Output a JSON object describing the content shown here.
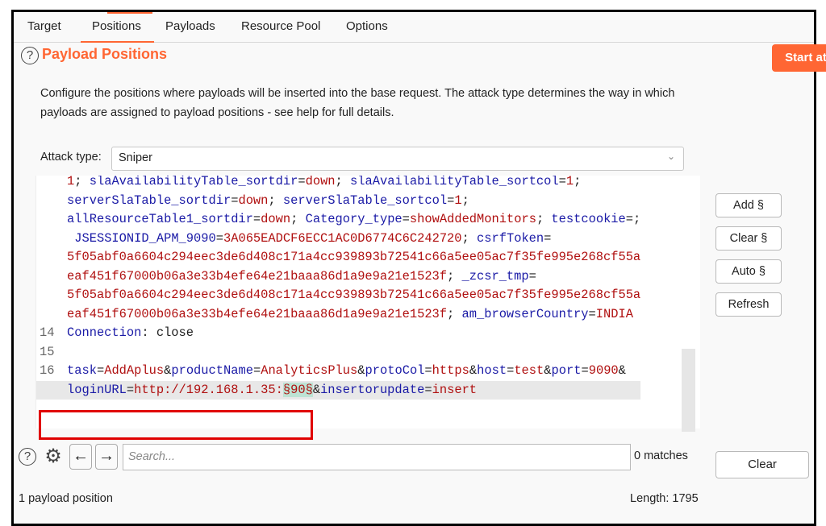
{
  "tabs": [
    {
      "label": "Target",
      "active": false
    },
    {
      "label": "Positions",
      "active": true
    },
    {
      "label": "Payloads",
      "active": false
    },
    {
      "label": "Resource Pool",
      "active": false
    },
    {
      "label": "Options",
      "active": false
    }
  ],
  "header": {
    "help_icon": "?",
    "title": "Payload Positions",
    "start_attack_label": "Start attack"
  },
  "description": "Configure the positions where payloads will be inserted into the base request. The attack type determines the way in which payloads are assigned to payload positions - see help for full details.",
  "attack_type": {
    "label": "Attack type:",
    "value": "Sniper"
  },
  "editor": {
    "lines": [
      {
        "num": "",
        "segments": [
          [
            "v",
            "1"
          ],
          [
            "p",
            "; "
          ],
          [
            "k",
            "slaAvailabilityTable_sortdir"
          ],
          [
            "p",
            "="
          ],
          [
            "v",
            "down"
          ],
          [
            "p",
            "; "
          ],
          [
            "k",
            "slaAvailabilityTable_sortcol"
          ],
          [
            "p",
            "="
          ],
          [
            "v",
            "1"
          ],
          [
            "p",
            ";"
          ]
        ]
      },
      {
        "num": "",
        "segments": [
          [
            "k",
            "serverSlaTable_sortdir"
          ],
          [
            "p",
            "="
          ],
          [
            "v",
            "down"
          ],
          [
            "p",
            "; "
          ],
          [
            "k",
            "serverSlaTable_sortcol"
          ],
          [
            "p",
            "="
          ],
          [
            "v",
            "1"
          ],
          [
            "p",
            ";"
          ]
        ]
      },
      {
        "num": "",
        "segments": [
          [
            "k",
            "allResourceTable1_sortdir"
          ],
          [
            "p",
            "="
          ],
          [
            "v",
            "down"
          ],
          [
            "p",
            "; "
          ],
          [
            "k",
            "Category_type"
          ],
          [
            "p",
            "="
          ],
          [
            "v",
            "showAddedMonitors"
          ],
          [
            "p",
            "; "
          ],
          [
            "k",
            "testcookie"
          ],
          [
            "p",
            "=;"
          ]
        ]
      },
      {
        "num": "",
        "segments": [
          [
            "p",
            " "
          ],
          [
            "k",
            "JSESSIONID_APM_9090"
          ],
          [
            "p",
            "="
          ],
          [
            "v",
            "3A065EADCF6ECC1AC0D6774C6C242720"
          ],
          [
            "p",
            "; "
          ],
          [
            "k",
            "csrfToken"
          ],
          [
            "p",
            "="
          ]
        ]
      },
      {
        "num": "",
        "segments": [
          [
            "v",
            "5f05abf0a6604c294eec3de6d408c171a4cc939893b72541c66a5ee05ac7f35fe995e268cf55a"
          ]
        ]
      },
      {
        "num": "",
        "segments": [
          [
            "v",
            "eaf451f67000b06a3e33b4efe64e21baaa86d1a9e9a21e1523f"
          ],
          [
            "p",
            "; "
          ],
          [
            "k",
            "_zcsr_tmp"
          ],
          [
            "p",
            "="
          ]
        ]
      },
      {
        "num": "",
        "segments": [
          [
            "v",
            "5f05abf0a6604c294eec3de6d408c171a4cc939893b72541c66a5ee05ac7f35fe995e268cf55a"
          ]
        ]
      },
      {
        "num": "",
        "segments": [
          [
            "v",
            "eaf451f67000b06a3e33b4efe64e21baaa86d1a9e9a21e1523f"
          ],
          [
            "p",
            "; "
          ],
          [
            "k",
            "am_browserCountry"
          ],
          [
            "p",
            "="
          ],
          [
            "v",
            "INDIA"
          ]
        ]
      },
      {
        "num": "14",
        "segments": [
          [
            "k",
            "Connection"
          ],
          [
            "p",
            ": close"
          ]
        ]
      },
      {
        "num": "15",
        "segments": []
      },
      {
        "num": "16",
        "segments": [
          [
            "k",
            "task"
          ],
          [
            "p",
            "="
          ],
          [
            "v",
            "AddAplus"
          ],
          [
            "p",
            "&"
          ],
          [
            "k",
            "productName"
          ],
          [
            "p",
            "="
          ],
          [
            "v",
            "AnalyticsPlus"
          ],
          [
            "p",
            "&"
          ],
          [
            "k",
            "protoCol"
          ],
          [
            "p",
            "="
          ],
          [
            "v",
            "https"
          ],
          [
            "p",
            "&"
          ],
          [
            "k",
            "host"
          ],
          [
            "p",
            "="
          ],
          [
            "v",
            "test"
          ],
          [
            "p",
            "&"
          ],
          [
            "k",
            "port"
          ],
          [
            "p",
            "="
          ],
          [
            "v",
            "9090"
          ],
          [
            "p",
            "&"
          ]
        ]
      },
      {
        "num": "",
        "highlight": true,
        "segments": [
          [
            "k",
            "loginURL"
          ],
          [
            "p",
            "="
          ],
          [
            "v",
            "http://192.168.1.35:"
          ],
          [
            "m",
            "§90§"
          ],
          [
            "p",
            "&"
          ],
          [
            "k",
            "insertorupdate"
          ],
          [
            "p",
            "="
          ],
          [
            "v",
            "insert"
          ]
        ]
      }
    ]
  },
  "side_buttons": [
    "Add §",
    "Clear §",
    "Auto §",
    "Refresh"
  ],
  "search": {
    "placeholder": "Search...",
    "value": "",
    "matches": "0 matches",
    "clear_label": "Clear"
  },
  "status": {
    "positions": "1 payload position",
    "length": "Length: 1795"
  },
  "colors": {
    "accent": "#ff6633",
    "key": "#1a1aa6",
    "value": "#b01010",
    "marker_bg": "#bde3d4",
    "annotation_box": "#e00000"
  }
}
